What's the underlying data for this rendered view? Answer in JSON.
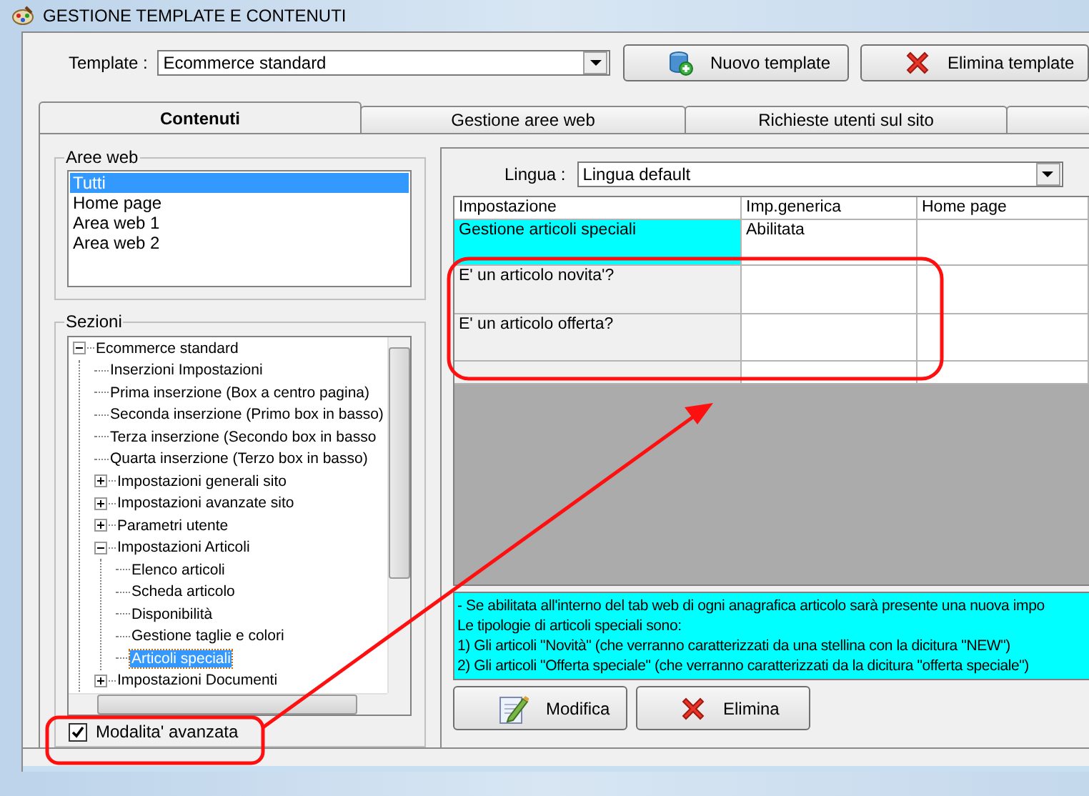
{
  "window": {
    "title": "GESTIONE TEMPLATE E CONTENUTI"
  },
  "template": {
    "label": "Template :",
    "value": "Ecommerce standard"
  },
  "toolbar_buttons": [
    {
      "label": "Nuovo template",
      "kind": "add"
    },
    {
      "label": "Elimina template",
      "kind": "delete"
    }
  ],
  "tabs": [
    {
      "label": "Contenuti",
      "selected": true
    },
    {
      "label": "Gestione aree web",
      "selected": false
    },
    {
      "label": "Richieste utenti sul sito",
      "selected": false
    }
  ],
  "aree_web": {
    "title": "Aree web",
    "items": [
      {
        "label": "Tutti",
        "selected": true
      },
      {
        "label": "Home page",
        "selected": false
      },
      {
        "label": "Area web 1",
        "selected": false
      },
      {
        "label": "Area web 2",
        "selected": false
      }
    ]
  },
  "sezioni": {
    "title": "Sezioni",
    "tree": [
      {
        "label": "Ecommerce standard",
        "expanded": true,
        "selected": false,
        "children": [
          {
            "label": "Inserzioni Impostazioni",
            "selected": false
          },
          {
            "label": "Prima inserzione (Box a centro pagina)",
            "selected": false
          },
          {
            "label": "Seconda inserzione (Primo box in basso)",
            "selected": false
          },
          {
            "label": "Terza inserzione (Secondo box in basso",
            "selected": false
          },
          {
            "label": "Quarta inserzione (Terzo box in basso)",
            "selected": false
          },
          {
            "label": "Impostazioni generali sito",
            "expanded": false,
            "selected": false
          },
          {
            "label": "Impostazioni avanzate sito",
            "expanded": false,
            "selected": false
          },
          {
            "label": "Parametri utente",
            "expanded": false,
            "selected": false
          },
          {
            "label": "Impostazioni Articoli",
            "expanded": true,
            "selected": false,
            "children": [
              {
                "label": "Elenco articoli",
                "selected": false
              },
              {
                "label": "Scheda articolo",
                "selected": false
              },
              {
                "label": "Disponibilità",
                "selected": false
              },
              {
                "label": "Gestione taglie e colori",
                "selected": false
              },
              {
                "label": "Articoli speciali",
                "selected": true
              }
            ]
          },
          {
            "label": "Impostazioni Documenti",
            "expanded": false,
            "selected": false
          }
        ]
      }
    ]
  },
  "advanced_mode": {
    "label": "Modalita' avanzata",
    "checked": true
  },
  "lingua": {
    "label": "Lingua :",
    "value": "Lingua default"
  },
  "grid": {
    "columns": [
      "Impostazione",
      "Imp.generica",
      "Home page"
    ],
    "rows": [
      {
        "setting": "Gestione articoli speciali",
        "generic": "Abilitata",
        "selected": true
      },
      {
        "setting": "E' un articolo novita'?",
        "selected": false
      },
      {
        "setting": "E' un articolo offerta?",
        "selected": false
      }
    ]
  },
  "info": {
    "lines": [
      "- Se abilitata all'interno del tab web di ogni anagrafica articolo sarà presente una nuova impo",
      "Le tipologie di articoli speciali sono:",
      "1) Gli articoli \"Novità\" (che verranno caratterizzati da una stellina con la dicitura \"NEW\")",
      "2) Gli articoli \"Offerta speciale\" (che verranno caratterizzati da la dicitura \"offerta speciale\")"
    ]
  },
  "actions": [
    {
      "label": "Modifica",
      "kind": "edit"
    },
    {
      "label": "Elimina",
      "kind": "delete"
    }
  ]
}
